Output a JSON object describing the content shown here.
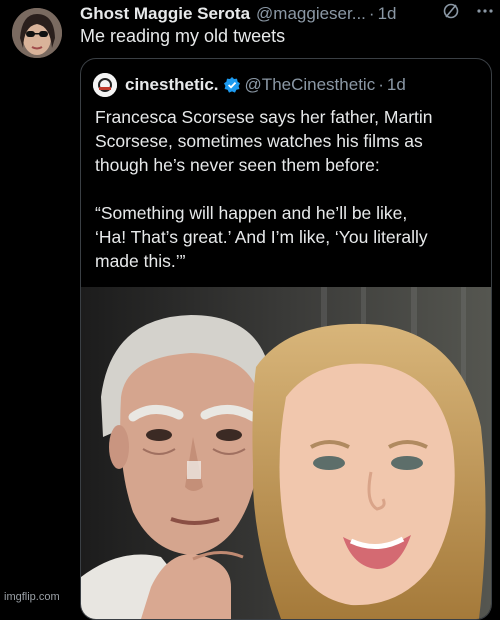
{
  "tweet": {
    "author_name": "Ghost Maggie Serota",
    "author_handle": "@maggieser...",
    "separator": "·",
    "time": "1d",
    "text": "Me reading my old tweets"
  },
  "quote": {
    "author_name": "cinesthetic.",
    "author_handle": "@TheCinesthetic",
    "separator": "·",
    "time": "1d",
    "paragraph1": "Francesca Scorsese says her father, Martin\nScorsese, sometimes watches his films as\nthough he’s never seen them before:",
    "paragraph2": "“Something will happen and he’ll be like,\n‘Ha! That’s great.’ And I’m like, ‘You literally\nmade this.’”"
  },
  "icons": {
    "grok": "slash-circle-icon",
    "more": "more-horizontal-icon",
    "verified": "verified-badge-icon"
  },
  "colors": {
    "background": "#000000",
    "text": "#e7e9ea",
    "muted": "#8b98a5",
    "verified": "#1d9bf0"
  },
  "watermark": "imgflip.com"
}
